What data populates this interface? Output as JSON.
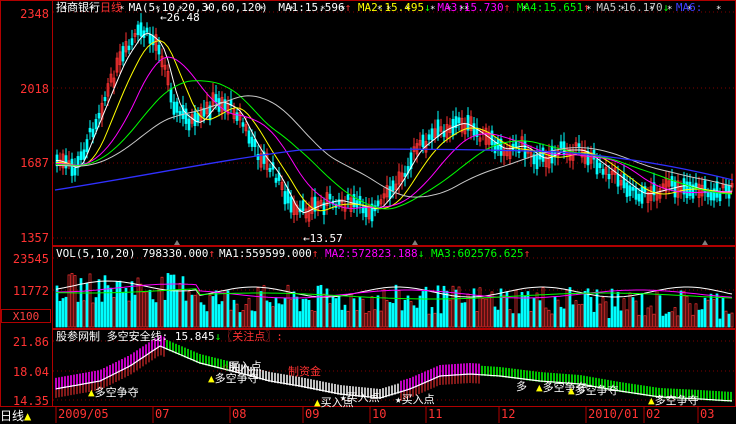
{
  "price_panel": {
    "stock_name": "招商银行",
    "period": "日线",
    "ma_params": "MA(5,10,20,30,60,120)",
    "ma1": {
      "label": "MA1:",
      "value": "15.596",
      "arrow": "↑"
    },
    "ma2": {
      "label": "MA2:",
      "value": "15.495",
      "arrow": "↓"
    },
    "ma3": {
      "label": "MA3:",
      "value": "15.730",
      "arrow": "↑"
    },
    "ma4": {
      "label": "MA4:",
      "value": "15.651",
      "arrow": "↑"
    },
    "ma5": {
      "label": "MA5:",
      "value": "16.170",
      "arrow": "↓"
    },
    "ma6": {
      "label": "MA6:"
    },
    "high_note": "26.48",
    "low_note": "13.57",
    "y_ticks": [
      "2348",
      "2018",
      "1687",
      "1357"
    ]
  },
  "volume_panel": {
    "title": "VOL(5,10,20)",
    "vol_value": "798330.000",
    "vol_arrow": "↑",
    "ma1": {
      "label": "MA1:",
      "value": "559599.000",
      "arrow": "↑"
    },
    "ma2": {
      "label": "MA2:",
      "value": "572823.188",
      "arrow": "↓"
    },
    "ma3": {
      "label": "MA3:",
      "value": "602576.625",
      "arrow": "↑"
    },
    "y_ticks": [
      "23545",
      "11772"
    ],
    "unit_button": "X100"
  },
  "indicator_panel": {
    "title": "股参网制",
    "line_label": "多空安全线:",
    "line_value": "15.845",
    "line_arrow": "↓",
    "focus_label": "〖关注点〗:",
    "y_ticks": [
      "21.86",
      "18.04",
      "14.35"
    ],
    "signals": [
      "多空争夺",
      "多空争夺",
      "多空争夺",
      "多空争夺",
      "多空争夺"
    ],
    "buy_point": "买入点",
    "buy_point2": "买入点",
    "buy_point3": "买入点",
    "buy_point4": "买入点",
    "fund": "制资金",
    "ex_label": "多"
  },
  "time_axis": {
    "tab": "日线",
    "labels": [
      "2009/05",
      "07",
      "08",
      "09",
      "10",
      "11",
      "12",
      "2010/01",
      "02",
      "03"
    ]
  },
  "colors": {
    "up": "#ff3232",
    "down": "#00ffff",
    "ma1": "#ffffff",
    "ma2": "#ffff00",
    "ma3": "#ff00ff",
    "ma4": "#00ff00",
    "ma5": "#c8c8c8",
    "ma6": "#0000ff",
    "frame": "#b00000"
  }
}
